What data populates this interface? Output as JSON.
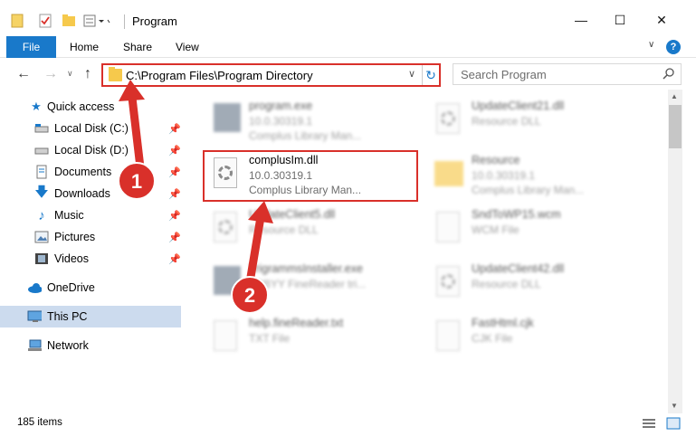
{
  "window": {
    "title": "Program"
  },
  "ribbon": {
    "file": "File",
    "home": "Home",
    "share": "Share",
    "view": "View",
    "help": "?"
  },
  "address": {
    "path": "C:\\Program Files\\Program Directory"
  },
  "search": {
    "placeholder": "Search Program"
  },
  "sidebar": {
    "items": [
      {
        "label": "Quick access"
      },
      {
        "label": "Local Disk (C:)"
      },
      {
        "label": "Local Disk (D:)"
      },
      {
        "label": "Documents"
      },
      {
        "label": "Downloads"
      },
      {
        "label": "Music"
      },
      {
        "label": "Pictures"
      },
      {
        "label": "Videos"
      },
      {
        "label": "OneDrive"
      },
      {
        "label": "This PC"
      },
      {
        "label": "Network"
      }
    ]
  },
  "files": [
    {
      "name": "program.exe",
      "meta1": "10.0.30319.1",
      "meta2": "Complus Library Man..."
    },
    {
      "name": "UpdateClient21.dll",
      "meta1": "Resource DLL",
      "meta2": ""
    },
    {
      "name": "complusIm.dll",
      "meta1": "10.0.30319.1",
      "meta2": "Complus Library Man..."
    },
    {
      "name": "Resource",
      "meta1": "10.0.30319.1",
      "meta2": "Complus Library Man..."
    },
    {
      "name": "UpdateClient5.dll",
      "meta1": "Resource DLL",
      "meta2": ""
    },
    {
      "name": "SndToWP15.wcm",
      "meta1": "WCM File",
      "meta2": ""
    },
    {
      "name": "TrigrammsInstaller.exe",
      "meta1": "ABBYY FineReader tri...",
      "meta2": ""
    },
    {
      "name": "UpdateClient42.dll",
      "meta1": "Resource DLL",
      "meta2": ""
    },
    {
      "name": "help.fineReader.txt",
      "meta1": "TXT File",
      "meta2": ""
    },
    {
      "name": "FastHtml.cjk",
      "meta1": "CJK File",
      "meta2": ""
    }
  ],
  "callouts": {
    "one": "1",
    "two": "2"
  },
  "status": {
    "count": "185 items"
  },
  "colors": {
    "accent": "#1979ca",
    "highlight": "#d9302a",
    "selected": "#ccdbee"
  }
}
